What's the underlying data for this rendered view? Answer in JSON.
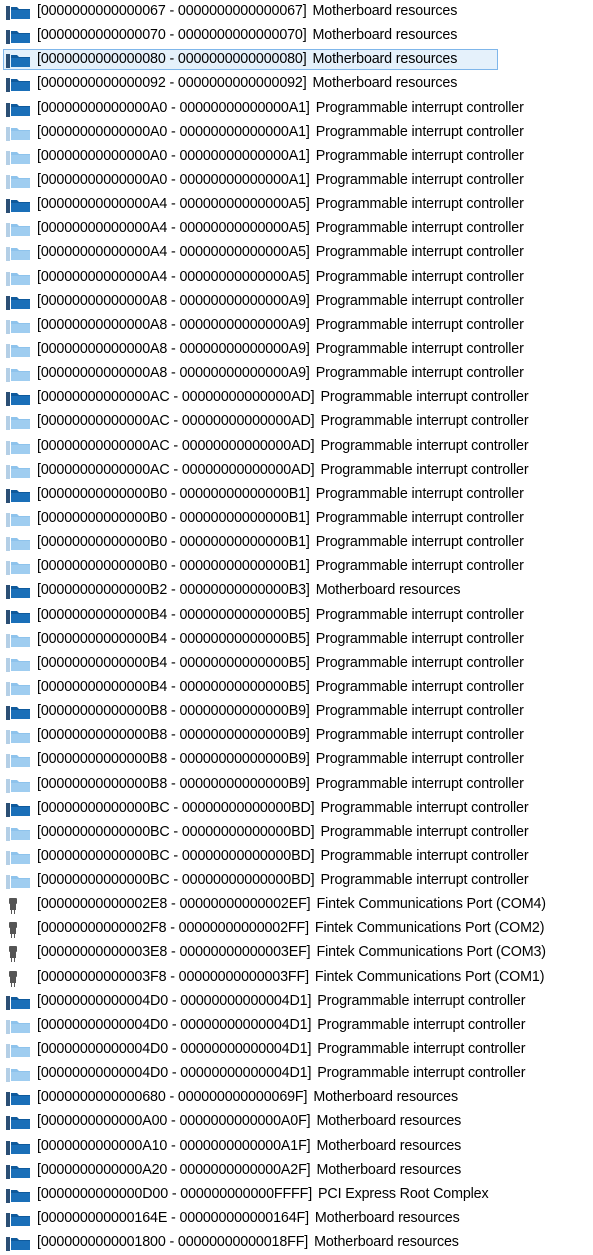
{
  "colors": {
    "folder_dark": "#1a6fb8",
    "folder_light": "#9fcdf0",
    "selection_border": "#7fb6ea",
    "selection_fill": "#e5f1fb",
    "port_icon": "#555555"
  },
  "rows": [
    {
      "range": "[0000000000000067 - 0000000000000067]",
      "name": "Motherboard resources",
      "icon": "folder-dark"
    },
    {
      "range": "[0000000000000070 - 0000000000000070]",
      "name": "Motherboard resources",
      "icon": "folder-dark"
    },
    {
      "range": "[0000000000000080 - 0000000000000080]",
      "name": "Motherboard resources",
      "icon": "folder-dark",
      "selected": true
    },
    {
      "range": "[0000000000000092 - 0000000000000092]",
      "name": "Motherboard resources",
      "icon": "folder-dark"
    },
    {
      "range": "[00000000000000A0 - 00000000000000A1]",
      "name": "Programmable interrupt controller",
      "icon": "folder-dark"
    },
    {
      "range": "[00000000000000A0 - 00000000000000A1]",
      "name": "Programmable interrupt controller",
      "icon": "folder-light"
    },
    {
      "range": "[00000000000000A0 - 00000000000000A1]",
      "name": "Programmable interrupt controller",
      "icon": "folder-light"
    },
    {
      "range": "[00000000000000A0 - 00000000000000A1]",
      "name": "Programmable interrupt controller",
      "icon": "folder-light"
    },
    {
      "range": "[00000000000000A4 - 00000000000000A5]",
      "name": "Programmable interrupt controller",
      "icon": "folder-dark"
    },
    {
      "range": "[00000000000000A4 - 00000000000000A5]",
      "name": "Programmable interrupt controller",
      "icon": "folder-light"
    },
    {
      "range": "[00000000000000A4 - 00000000000000A5]",
      "name": "Programmable interrupt controller",
      "icon": "folder-light"
    },
    {
      "range": "[00000000000000A4 - 00000000000000A5]",
      "name": "Programmable interrupt controller",
      "icon": "folder-light"
    },
    {
      "range": "[00000000000000A8 - 00000000000000A9]",
      "name": "Programmable interrupt controller",
      "icon": "folder-dark"
    },
    {
      "range": "[00000000000000A8 - 00000000000000A9]",
      "name": "Programmable interrupt controller",
      "icon": "folder-light"
    },
    {
      "range": "[00000000000000A8 - 00000000000000A9]",
      "name": "Programmable interrupt controller",
      "icon": "folder-light"
    },
    {
      "range": "[00000000000000A8 - 00000000000000A9]",
      "name": "Programmable interrupt controller",
      "icon": "folder-light"
    },
    {
      "range": "[00000000000000AC - 00000000000000AD]",
      "name": "Programmable interrupt controller",
      "icon": "folder-dark"
    },
    {
      "range": "[00000000000000AC - 00000000000000AD]",
      "name": "Programmable interrupt controller",
      "icon": "folder-light"
    },
    {
      "range": "[00000000000000AC - 00000000000000AD]",
      "name": "Programmable interrupt controller",
      "icon": "folder-light"
    },
    {
      "range": "[00000000000000AC - 00000000000000AD]",
      "name": "Programmable interrupt controller",
      "icon": "folder-light"
    },
    {
      "range": "[00000000000000B0 - 00000000000000B1]",
      "name": "Programmable interrupt controller",
      "icon": "folder-dark"
    },
    {
      "range": "[00000000000000B0 - 00000000000000B1]",
      "name": "Programmable interrupt controller",
      "icon": "folder-light"
    },
    {
      "range": "[00000000000000B0 - 00000000000000B1]",
      "name": "Programmable interrupt controller",
      "icon": "folder-light"
    },
    {
      "range": "[00000000000000B0 - 00000000000000B1]",
      "name": "Programmable interrupt controller",
      "icon": "folder-light"
    },
    {
      "range": "[00000000000000B2 - 00000000000000B3]",
      "name": "Motherboard resources",
      "icon": "folder-dark"
    },
    {
      "range": "[00000000000000B4 - 00000000000000B5]",
      "name": "Programmable interrupt controller",
      "icon": "folder-dark"
    },
    {
      "range": "[00000000000000B4 - 00000000000000B5]",
      "name": "Programmable interrupt controller",
      "icon": "folder-light"
    },
    {
      "range": "[00000000000000B4 - 00000000000000B5]",
      "name": "Programmable interrupt controller",
      "icon": "folder-light"
    },
    {
      "range": "[00000000000000B4 - 00000000000000B5]",
      "name": "Programmable interrupt controller",
      "icon": "folder-light"
    },
    {
      "range": "[00000000000000B8 - 00000000000000B9]",
      "name": "Programmable interrupt controller",
      "icon": "folder-dark"
    },
    {
      "range": "[00000000000000B8 - 00000000000000B9]",
      "name": "Programmable interrupt controller",
      "icon": "folder-light"
    },
    {
      "range": "[00000000000000B8 - 00000000000000B9]",
      "name": "Programmable interrupt controller",
      "icon": "folder-light"
    },
    {
      "range": "[00000000000000B8 - 00000000000000B9]",
      "name": "Programmable interrupt controller",
      "icon": "folder-light"
    },
    {
      "range": "[00000000000000BC - 00000000000000BD]",
      "name": "Programmable interrupt controller",
      "icon": "folder-dark"
    },
    {
      "range": "[00000000000000BC - 00000000000000BD]",
      "name": "Programmable interrupt controller",
      "icon": "folder-light"
    },
    {
      "range": "[00000000000000BC - 00000000000000BD]",
      "name": "Programmable interrupt controller",
      "icon": "folder-light"
    },
    {
      "range": "[00000000000000BC - 00000000000000BD]",
      "name": "Programmable interrupt controller",
      "icon": "folder-light"
    },
    {
      "range": "[00000000000002E8 - 00000000000002EF]",
      "name": "Fintek Communications Port (COM4)",
      "icon": "port"
    },
    {
      "range": "[00000000000002F8 - 00000000000002FF]",
      "name": "Fintek Communications Port (COM2)",
      "icon": "port"
    },
    {
      "range": "[00000000000003E8 - 00000000000003EF]",
      "name": "Fintek Communications Port (COM3)",
      "icon": "port"
    },
    {
      "range": "[00000000000003F8 - 00000000000003FF]",
      "name": "Fintek Communications Port (COM1)",
      "icon": "port"
    },
    {
      "range": "[00000000000004D0 - 00000000000004D1]",
      "name": "Programmable interrupt controller",
      "icon": "folder-dark"
    },
    {
      "range": "[00000000000004D0 - 00000000000004D1]",
      "name": "Programmable interrupt controller",
      "icon": "folder-light"
    },
    {
      "range": "[00000000000004D0 - 00000000000004D1]",
      "name": "Programmable interrupt controller",
      "icon": "folder-light"
    },
    {
      "range": "[00000000000004D0 - 00000000000004D1]",
      "name": "Programmable interrupt controller",
      "icon": "folder-light"
    },
    {
      "range": "[0000000000000680 - 000000000000069F]",
      "name": "Motherboard resources",
      "icon": "folder-dark"
    },
    {
      "range": "[0000000000000A00 - 0000000000000A0F]",
      "name": "Motherboard resources",
      "icon": "folder-dark"
    },
    {
      "range": "[0000000000000A10 - 0000000000000A1F]",
      "name": "Motherboard resources",
      "icon": "folder-dark"
    },
    {
      "range": "[0000000000000A20 - 0000000000000A2F]",
      "name": "Motherboard resources",
      "icon": "folder-dark"
    },
    {
      "range": "[0000000000000D00 - 000000000000FFFF]",
      "name": "PCI Express Root Complex",
      "icon": "folder-dark"
    },
    {
      "range": "[000000000000164E - 000000000000164F]",
      "name": "Motherboard resources",
      "icon": "folder-dark"
    },
    {
      "range": "[0000000000001800 - 00000000000018FF]",
      "name": "Motherboard resources",
      "icon": "folder-dark"
    }
  ]
}
